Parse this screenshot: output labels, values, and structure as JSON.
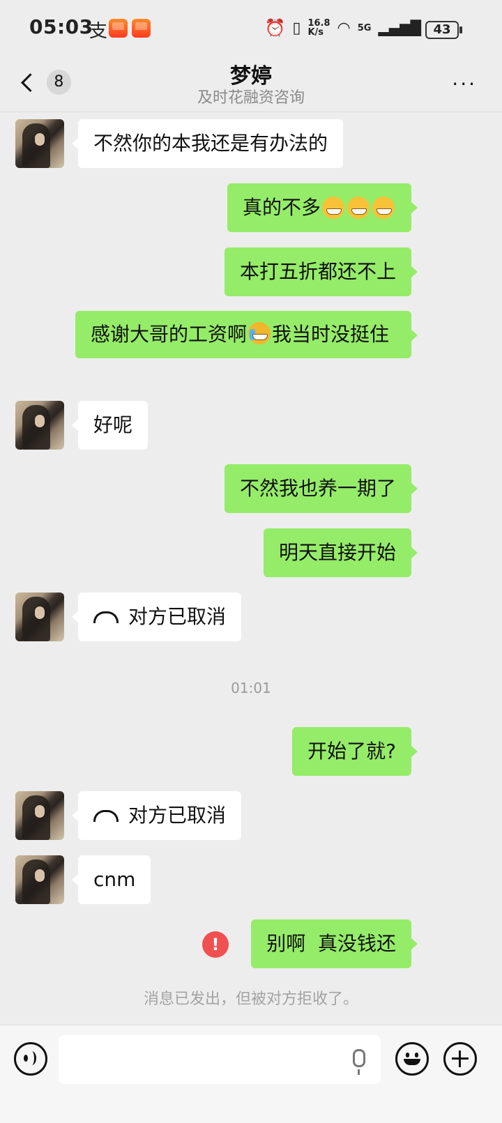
{
  "status_bar": {
    "time": "05:03",
    "alipay_glyph": "支",
    "net_speed_value": "16.8",
    "net_speed_unit": "K/s",
    "network": "5G",
    "battery": "43"
  },
  "header": {
    "back_count": "8",
    "title": "梦婷",
    "subtitle": "及时花融资咨询",
    "more": "···"
  },
  "messages": [
    {
      "from": "them",
      "text": "不然你的本我还是有办法的"
    },
    {
      "from": "me",
      "text": "真的不多",
      "emojis": [
        "grin-icon",
        "grin-icon",
        "grin-icon"
      ]
    },
    {
      "from": "me",
      "text": "本打五折都还不上"
    },
    {
      "from": "me",
      "text_before": "感谢大哥的工资啊",
      "emoji": "rolling-laugh-icon",
      "text_after": "我当时没挺住"
    },
    {
      "from": "them",
      "text": "好呢"
    },
    {
      "from": "me",
      "text": "不然我也养一期了"
    },
    {
      "from": "me",
      "text": "明天直接开始"
    },
    {
      "from": "them",
      "type": "call",
      "text": "对方已取消"
    },
    {
      "from": "me",
      "text": "开始了就?"
    },
    {
      "from": "them",
      "type": "call",
      "text": "对方已取消"
    },
    {
      "from": "them",
      "text": "cnm"
    },
    {
      "from": "me",
      "text": "别啊  真没钱还",
      "failed": true
    }
  ],
  "timestamp": "01:01",
  "failed_icon": "!",
  "system_note": "消息已发出，但被对方拒收了。",
  "input_bar": {
    "voice_icon": "voice-icon",
    "mic_icon": "mic-icon",
    "emoji_icon": "emoji-icon",
    "plus_icon": "plus-icon"
  }
}
